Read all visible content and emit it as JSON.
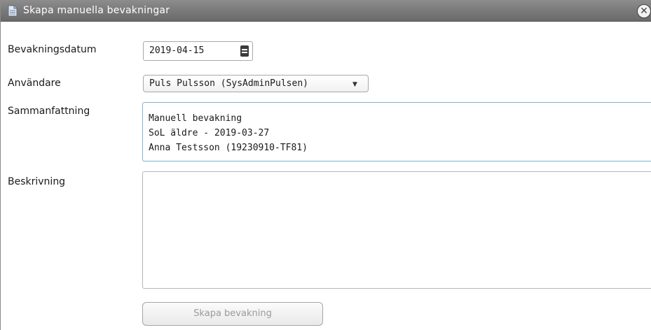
{
  "dialog": {
    "title": "Skapa manuella bevakningar",
    "title_icon": "document-icon",
    "close_icon": "close-icon",
    "close_glyph": "✕"
  },
  "form": {
    "date": {
      "label": "Bevakningsdatum",
      "value": "2019-04-15",
      "button_icon": "calendar-icon"
    },
    "user": {
      "label": "Användare",
      "selected": "Puls Pulsson (SysAdminPulsen)",
      "arrow": "▼"
    },
    "summary": {
      "label": "Sammanfattning",
      "lines": [
        "Manuell bevakning",
        "SoL äldre - 2019-03-27",
        "Anna Testsson (19230910-TF81)"
      ]
    },
    "description": {
      "label": "Beskrivning",
      "value": ""
    },
    "submit": {
      "label": "Skapa bevakning",
      "enabled": false
    }
  },
  "colors": {
    "titlebar": "#7a7a7a",
    "focus_border": "#7fb0d0",
    "disabled_text": "#9a9a9a"
  }
}
